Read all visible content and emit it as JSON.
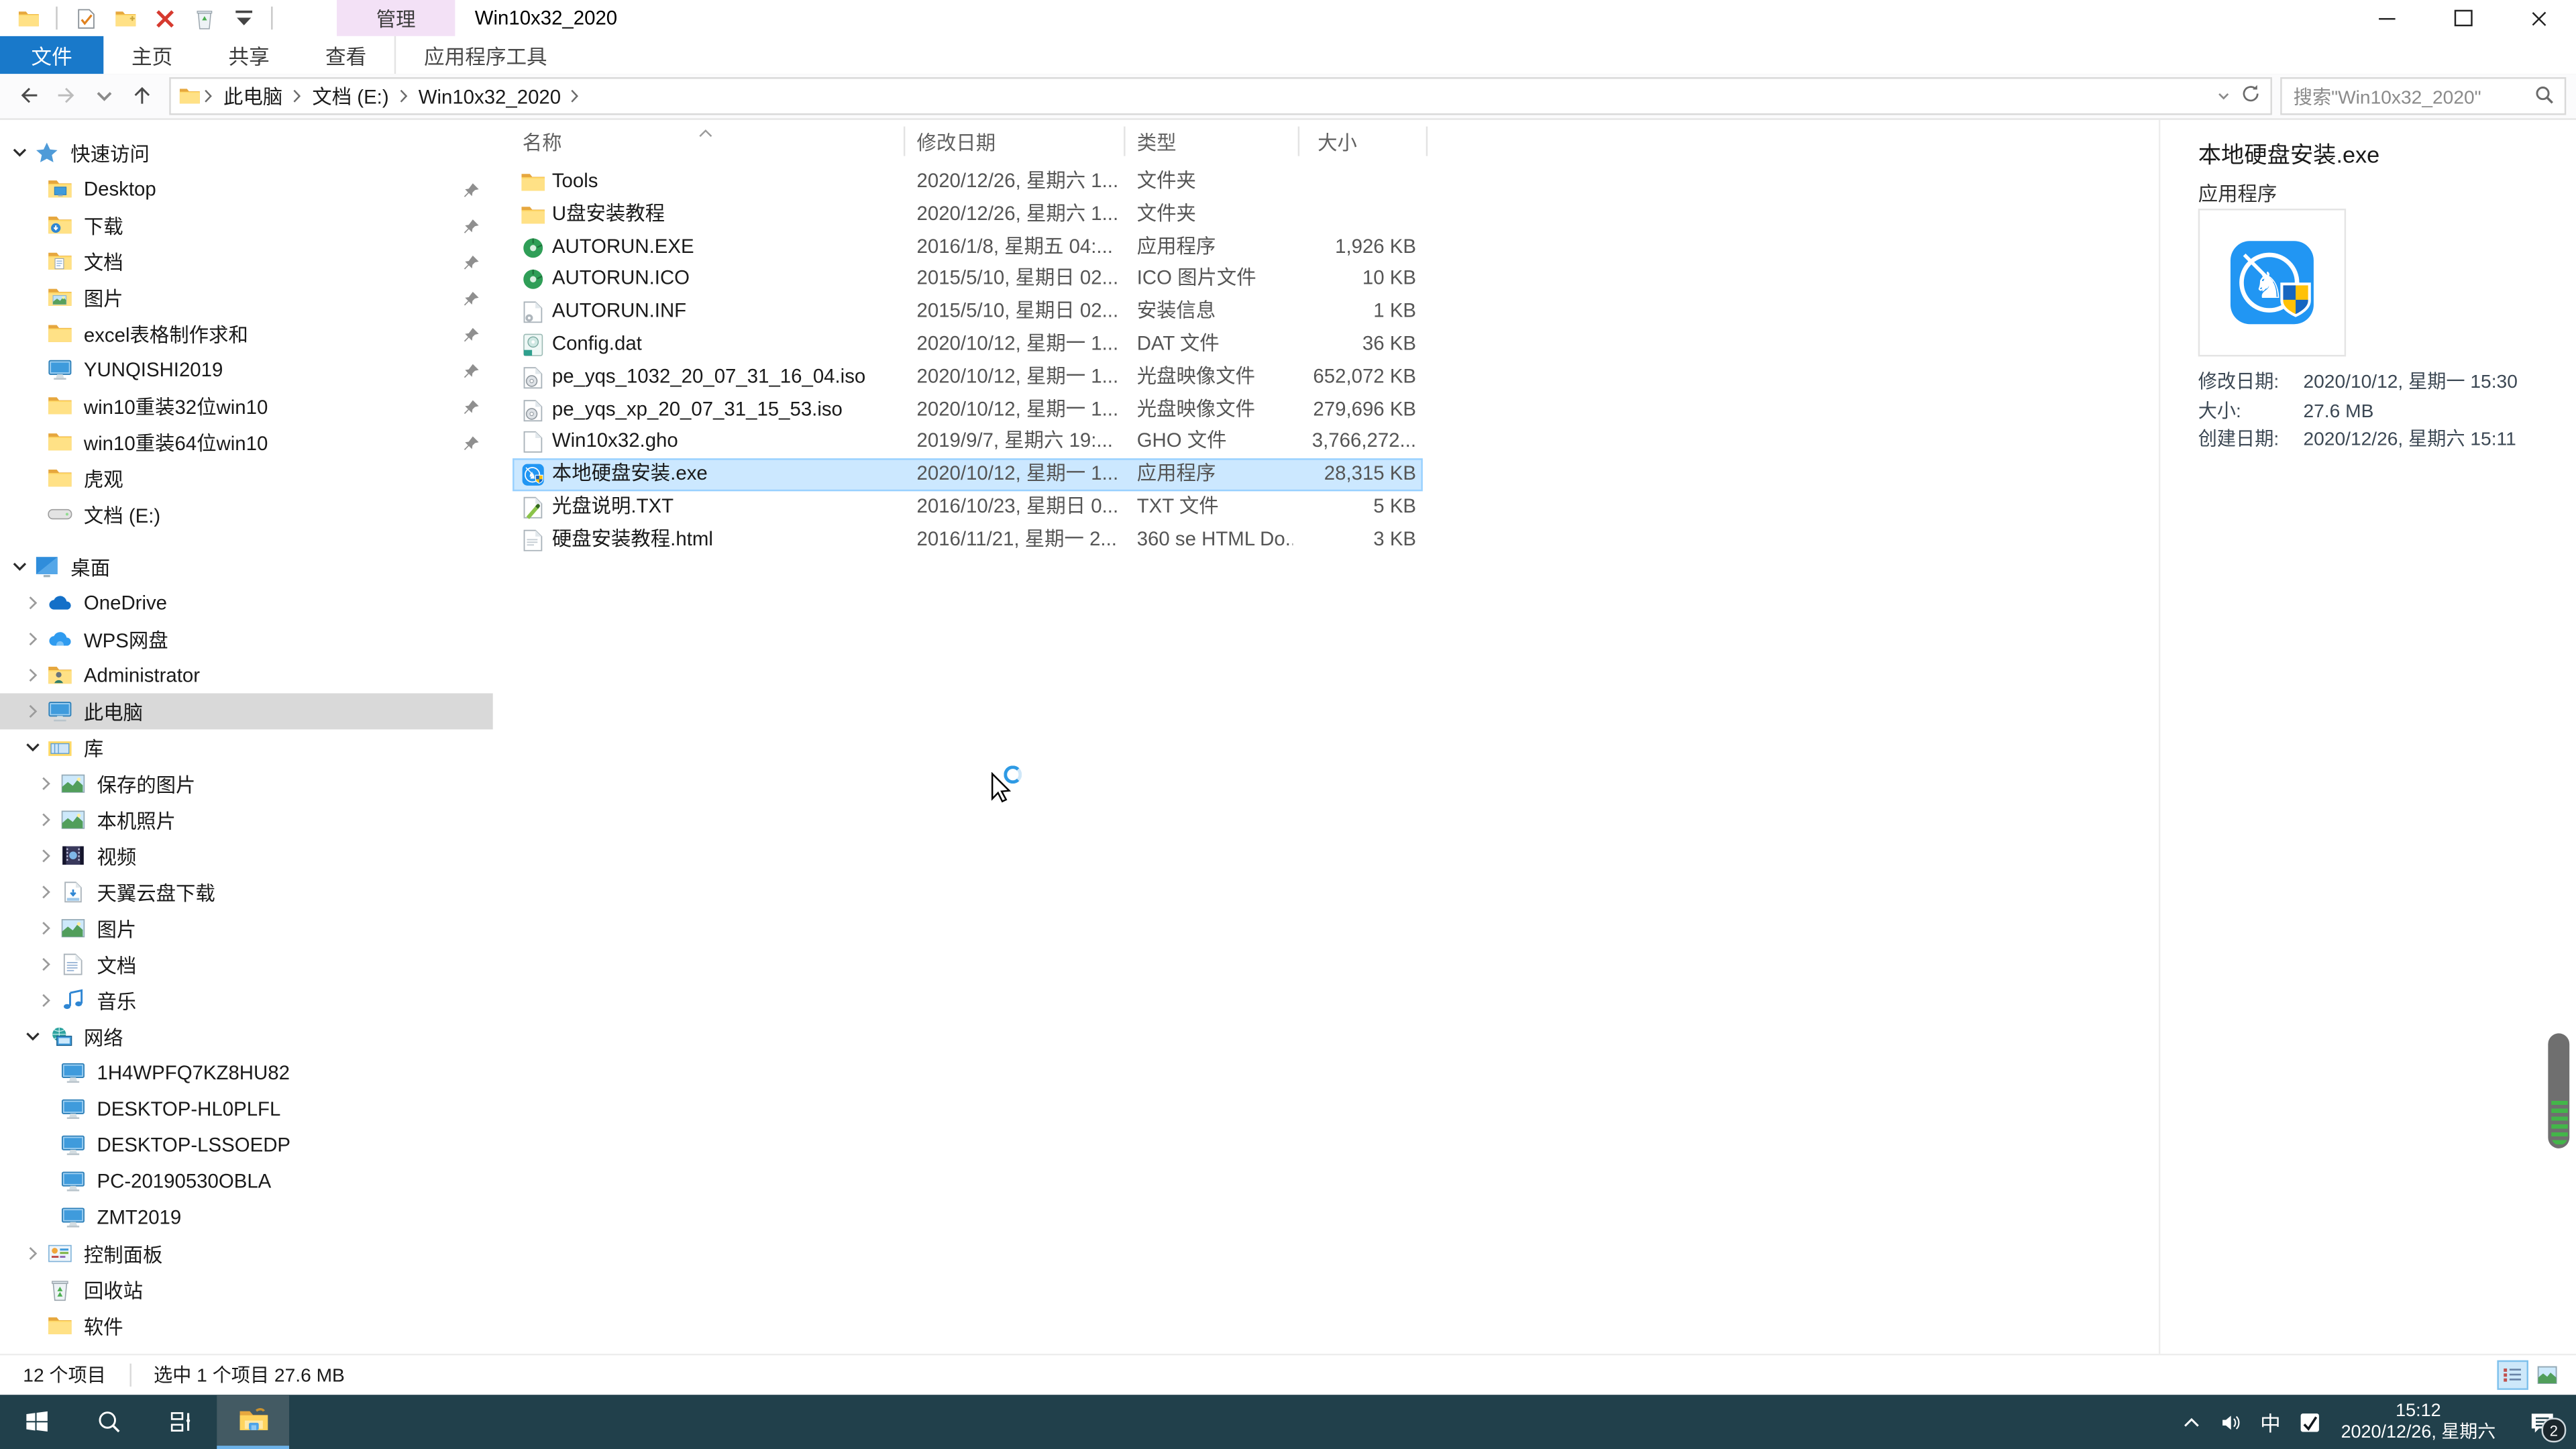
{
  "window": {
    "title": "Win10x32_2020",
    "context_tab": "管理"
  },
  "qat": {
    "items": [
      "folder-small",
      "separator",
      "properties-check",
      "new-folder",
      "delete-x",
      "recycle-small",
      "qat-dropdown",
      "separator"
    ]
  },
  "ribbon_tabs": [
    {
      "label": "文件",
      "active": true
    },
    {
      "label": "主页"
    },
    {
      "label": "共享"
    },
    {
      "label": "查看"
    },
    {
      "label": "应用程序工具",
      "tool": true
    }
  ],
  "address": {
    "breadcrumb": [
      "此电脑",
      "文档 (E:)",
      "Win10x32_2020"
    ]
  },
  "search": {
    "placeholder": "搜索\"Win10x32_2020\""
  },
  "sidebar": {
    "items": [
      {
        "label": "快速访问",
        "icon": "star",
        "level": 0,
        "chevron": "expanded"
      },
      {
        "label": "Desktop",
        "icon": "folder-desktop",
        "level": 1,
        "pinned": true
      },
      {
        "label": "下载",
        "icon": "folder-download",
        "level": 1,
        "pinned": true
      },
      {
        "label": "文档",
        "icon": "folder-docs",
        "level": 1,
        "pinned": true
      },
      {
        "label": "图片",
        "icon": "folder-pics",
        "level": 1,
        "pinned": true
      },
      {
        "label": "excel表格制作求和",
        "icon": "folder",
        "level": 1,
        "pinned": true
      },
      {
        "label": "YUNQISHI2019",
        "icon": "computer",
        "level": 1,
        "pinned": true
      },
      {
        "label": "win10重装32位win10",
        "icon": "folder",
        "level": 1,
        "pinned": true
      },
      {
        "label": "win10重装64位win10",
        "icon": "folder",
        "level": 1,
        "pinned": true
      },
      {
        "label": "虎观",
        "icon": "folder",
        "level": 1
      },
      {
        "label": "文档 (E:)",
        "icon": "drive",
        "level": 1
      },
      {
        "label": "桌面",
        "icon": "desktop",
        "level": 0,
        "chevron": "expanded",
        "gap_before": true
      },
      {
        "label": "OneDrive",
        "icon": "onedrive",
        "level": 1,
        "chevron": "collapsed"
      },
      {
        "label": "WPS网盘",
        "icon": "wpscloud",
        "level": 1,
        "chevron": "collapsed"
      },
      {
        "label": "Administrator",
        "icon": "user-folder",
        "level": 1,
        "chevron": "collapsed"
      },
      {
        "label": "此电脑",
        "icon": "computer",
        "level": 1,
        "chevron": "collapsed",
        "selected": true
      },
      {
        "label": "库",
        "icon": "library",
        "level": 1,
        "chevron": "expanded"
      },
      {
        "label": "保存的图片",
        "icon": "lib-pictures",
        "level": 2,
        "chevron": "collapsed"
      },
      {
        "label": "本机照片",
        "icon": "lib-pictures",
        "level": 2,
        "chevron": "collapsed"
      },
      {
        "label": "视频",
        "icon": "lib-video",
        "level": 2,
        "chevron": "collapsed"
      },
      {
        "label": "天翼云盘下载",
        "icon": "lib-download",
        "level": 2,
        "chevron": "collapsed"
      },
      {
        "label": "图片",
        "icon": "lib-pictures",
        "level": 2,
        "chevron": "collapsed"
      },
      {
        "label": "文档",
        "icon": "lib-docs",
        "level": 2,
        "chevron": "collapsed"
      },
      {
        "label": "音乐",
        "icon": "lib-music",
        "level": 2,
        "chevron": "collapsed"
      },
      {
        "label": "网络",
        "icon": "network",
        "level": 1,
        "chevron": "expanded"
      },
      {
        "label": "1H4WPFQ7KZ8HU82",
        "icon": "pc-node",
        "level": 2
      },
      {
        "label": "DESKTOP-HL0PLFL",
        "icon": "pc-node",
        "level": 2
      },
      {
        "label": "DESKTOP-LSSOEDP",
        "icon": "pc-node",
        "level": 2
      },
      {
        "label": "PC-20190530OBLA",
        "icon": "pc-node",
        "level": 2
      },
      {
        "label": "ZMT2019",
        "icon": "pc-node",
        "level": 2
      },
      {
        "label": "控制面板",
        "icon": "control-panel",
        "level": 1,
        "chevron": "collapsed"
      },
      {
        "label": "回收站",
        "icon": "recycle-bin",
        "level": 1
      },
      {
        "label": "软件",
        "icon": "folder",
        "level": 1
      }
    ]
  },
  "filelist": {
    "columns": [
      "名称",
      "修改日期",
      "类型",
      "大小"
    ],
    "rows": [
      {
        "icon": "folder",
        "name": "Tools",
        "date": "2020/12/26, 星期六 1...",
        "type": "文件夹",
        "size": ""
      },
      {
        "icon": "folder",
        "name": "U盘安装教程",
        "date": "2020/12/26, 星期六 1...",
        "type": "文件夹",
        "size": ""
      },
      {
        "icon": "exe-autorun",
        "name": "AUTORUN.EXE",
        "date": "2016/1/8, 星期五 04:...",
        "type": "应用程序",
        "size": "1,926 KB"
      },
      {
        "icon": "exe-autorun",
        "name": "AUTORUN.ICO",
        "date": "2015/5/10, 星期日 02...",
        "type": "ICO 图片文件",
        "size": "10 KB"
      },
      {
        "icon": "inf-file",
        "name": "AUTORUN.INF",
        "date": "2015/5/10, 星期日 02...",
        "type": "安装信息",
        "size": "1 KB"
      },
      {
        "icon": "dat-file",
        "name": "Config.dat",
        "date": "2020/10/12, 星期一 1...",
        "type": "DAT 文件",
        "size": "36 KB"
      },
      {
        "icon": "iso-file",
        "name": "pe_yqs_1032_20_07_31_16_04.iso",
        "date": "2020/10/12, 星期一 1...",
        "type": "光盘映像文件",
        "size": "652,072 KB"
      },
      {
        "icon": "iso-file",
        "name": "pe_yqs_xp_20_07_31_15_53.iso",
        "date": "2020/10/12, 星期一 1...",
        "type": "光盘映像文件",
        "size": "279,696 KB"
      },
      {
        "icon": "gho-file",
        "name": "Win10x32.gho",
        "date": "2019/9/7, 星期六 19:...",
        "type": "GHO 文件",
        "size": "3,766,272..."
      },
      {
        "icon": "app-local-install",
        "name": "本地硬盘安装.exe",
        "date": "2020/10/12, 星期一 1...",
        "type": "应用程序",
        "size": "28,315 KB",
        "selected": true
      },
      {
        "icon": "txt-file",
        "name": "光盘说明.TXT",
        "date": "2016/10/23, 星期日 0...",
        "type": "TXT 文件",
        "size": "5 KB"
      },
      {
        "icon": "html-file",
        "name": "硬盘安装教程.html",
        "date": "2016/11/21, 星期一 2...",
        "type": "360 se HTML Do...",
        "size": "3 KB"
      }
    ]
  },
  "details": {
    "title": "本地硬盘安装.exe",
    "subtitle": "应用程序",
    "icon": "app-local-install",
    "props": [
      {
        "label": "修改日期:",
        "value": "2020/10/12, 星期一 15:30"
      },
      {
        "label": "大小:",
        "value": "27.6 MB"
      },
      {
        "label": "创建日期:",
        "value": "2020/12/26, 星期六 15:11"
      }
    ]
  },
  "statusbar": {
    "items_count": "12 个项目",
    "selection": "选中 1 个项目  27.6 MB"
  },
  "taskbar": {
    "input_indicator": "中",
    "clock_time": "15:12",
    "clock_date": "2020/12/26, 星期六",
    "badge": "2"
  },
  "colors": {
    "accent_blue": "#1979ca",
    "selection": "#cce8ff",
    "taskbar": "#21404b",
    "context_tab_bg": "#f3e1f6",
    "pill_green": "#43b649"
  }
}
